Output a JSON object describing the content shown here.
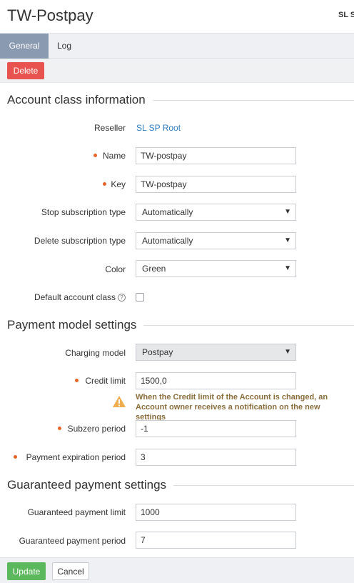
{
  "header": {
    "title": "TW-Postpay",
    "user": "SL SP Root"
  },
  "tabs": [
    {
      "label": "General"
    },
    {
      "label": "Log"
    }
  ],
  "toolbar": {
    "delete_label": "Delete"
  },
  "account_class": {
    "section_title": "Account class information",
    "reseller_label": "Reseller",
    "reseller_value": "SL SP Root",
    "name_label": "Name",
    "name_value": "TW-postpay",
    "key_label": "Key",
    "key_value": "TW-postpay",
    "stop_sub_label": "Stop subscription type",
    "stop_sub_value": "Automatically",
    "delete_sub_label": "Delete subscription type",
    "delete_sub_value": "Automatically",
    "color_label": "Color",
    "color_value": "Green",
    "default_label": "Default account class",
    "default_checked": false
  },
  "payment_model": {
    "section_title": "Payment model settings",
    "charging_label": "Charging model",
    "charging_value": "Postpay",
    "credit_label": "Credit limit",
    "credit_value": "1500,0",
    "warning_text": "When the Credit limit of the Account is changed, an Account owner receives a notification on the new settings",
    "subzero_label": "Subzero period",
    "subzero_value": "-1",
    "expiration_label": "Payment expiration period",
    "expiration_value": "3"
  },
  "guaranteed": {
    "section_title": "Guaranteed payment settings",
    "limit_label": "Guaranteed payment limit",
    "limit_value": "1000",
    "period_label": "Guaranteed payment period",
    "period_value": "7"
  },
  "footer": {
    "update_label": "Update",
    "cancel_label": "Cancel"
  },
  "colors": {
    "accent": "#8a9ab0",
    "delete": "#e9534f",
    "update": "#5cb85c",
    "link": "#2f7bbf",
    "required": "#e8652a",
    "warning": "#8a6d3b"
  }
}
